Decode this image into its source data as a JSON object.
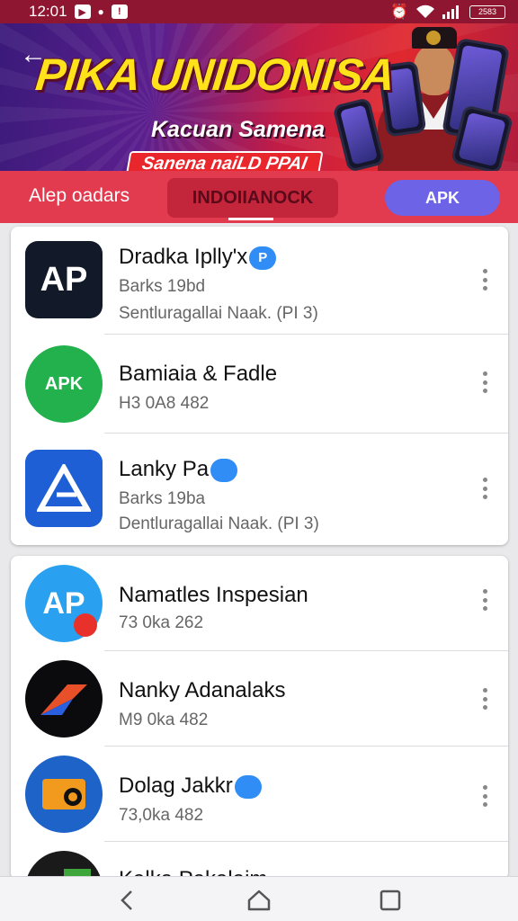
{
  "status_bar": {
    "time": "12:01",
    "battery": "2583"
  },
  "banner": {
    "title": "PIKA UNIDONISA",
    "subtitle": "Kaсuan Samena",
    "pill": "Sanena naiLD PPAI"
  },
  "tabs": {
    "left": "Alep oadars",
    "middle": "INDOIIANOCK",
    "apk": "APK"
  },
  "card1": [
    {
      "icon_text": "AP",
      "name": "Dradka Iplly'x",
      "verified_text": "P",
      "meta1": "Barks 19bd",
      "meta2": "Sentluragallai Naak. (PI 3)"
    },
    {
      "icon_text": "APK",
      "name": "Bamiaia & Fadle",
      "meta1": "H3 0A8 482"
    },
    {
      "icon_text": "",
      "name": "Lanky Pa",
      "verified_text": "",
      "meta1": "Barks 19ba",
      "meta2": "Dentluragallai Naak. (PI 3)"
    }
  ],
  "card2": [
    {
      "icon_text": "AP",
      "name": "Namatles Inspesian",
      "meta1": "73 0ka 262"
    },
    {
      "icon_text": "",
      "name": "Nanky Adanalaks",
      "meta1": "M9 0ka 482"
    },
    {
      "icon_text": "",
      "name": "Dolag Jakkr",
      "verified_text": "",
      "meta1": "73,0ka 482"
    },
    {
      "icon_text": "",
      "name": "Kalka Pakalaim",
      "meta1": ""
    }
  ],
  "colors": {
    "status_bar": "#8e1630",
    "tab_strip": "#e23a4e",
    "apk_button": "#6d63e6",
    "verified_badge": "#2f8df5"
  }
}
